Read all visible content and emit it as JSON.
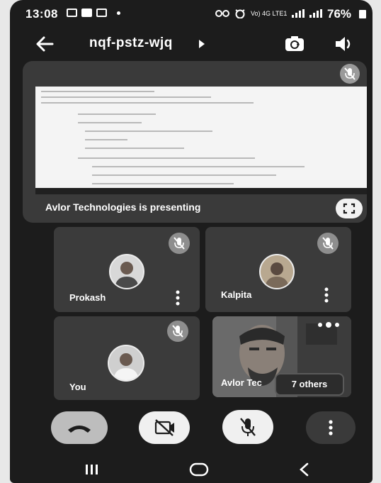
{
  "status_bar": {
    "time": "13:08",
    "battery_text": "76%",
    "network_label": "Vo) 4G LTE1"
  },
  "app_bar": {
    "meeting_code": "nqf-pstz-wjq",
    "back_icon": "arrow-left-icon",
    "switch_camera_icon": "switch-camera-icon",
    "speaker_icon": "speaker-icon"
  },
  "presentation": {
    "label": "Avlor Technologies is presenting",
    "fullscreen_icon": "fullscreen-icon"
  },
  "participants": [
    {
      "name": "Prokash",
      "muted": true
    },
    {
      "name": "Kalpita",
      "muted": true
    },
    {
      "name": "You",
      "muted": true
    },
    {
      "name": "Avlor Tec",
      "muted": false
    }
  ],
  "others_label": "7 others",
  "controls": {
    "end_call_icon": "end-call-icon",
    "camera_icon": "camera-off-icon",
    "mic_icon": "mic-off-icon",
    "more_icon": "more-vertical-icon"
  },
  "nav": {
    "recents_icon": "recents-icon",
    "home_icon": "home-icon",
    "back_icon": "back-icon"
  },
  "colors": {
    "background": "#1c1c1c",
    "tile": "#3b3b3b",
    "control_light": "#f0f0f0"
  }
}
